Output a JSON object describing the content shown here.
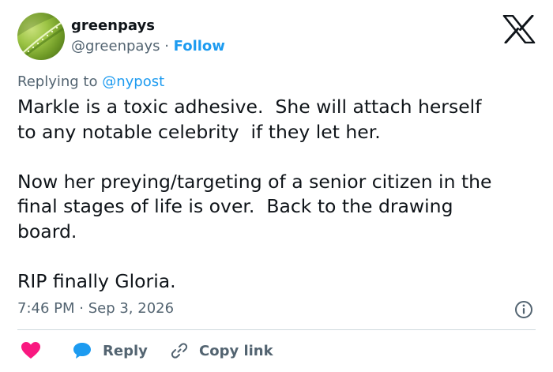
{
  "author": {
    "display_name": "greenpays",
    "handle": "@greenpays",
    "separator": " · ",
    "follow_label": "Follow"
  },
  "reply_context": {
    "prefix": "Replying to ",
    "mention": "@nypost"
  },
  "tweet": {
    "text": "Markle is a toxic adhesive.  She will attach herself\nto any notable celebrity  if they let her.\n\nNow her preying/targeting of a senior citizen in the\nfinal stages of life is over.  Back to the drawing\nboard.\n\nRIP finally Gloria.",
    "timestamp": "7:46 PM · Sep 3, 2026"
  },
  "actions": {
    "reply_label": "Reply",
    "copy_link_label": "Copy link"
  },
  "colors": {
    "accent": "#1d9bf0",
    "heart": "#f91880",
    "text_primary": "#0f1419",
    "text_secondary": "#536471"
  }
}
